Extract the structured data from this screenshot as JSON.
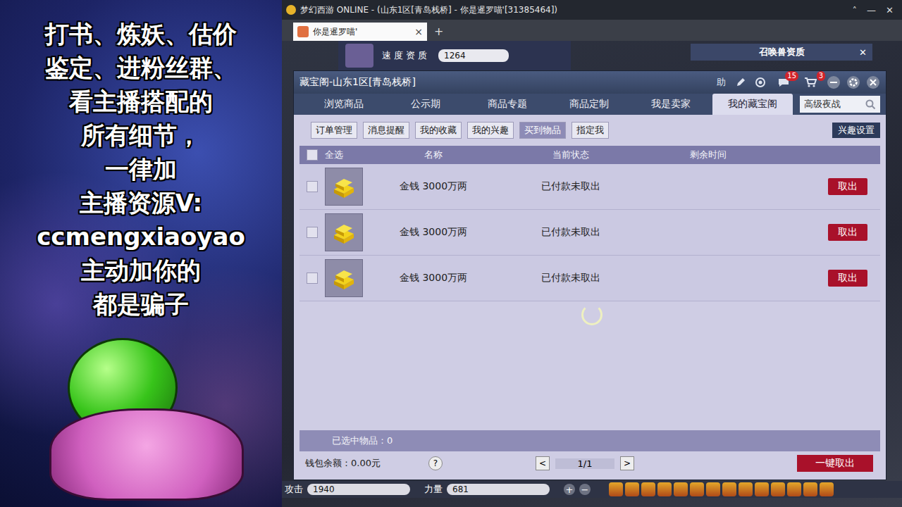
{
  "overlay": {
    "lines": [
      "打书、炼妖、估价",
      "鉴定、进粉丝群、",
      "看主播搭配的",
      "所有细节，",
      "一律加",
      "主播资源V:",
      "ccmengxiaoyao",
      "主动加你的",
      "都是骗子"
    ]
  },
  "window": {
    "title": "梦幻西游 ONLINE - (山东1区[青岛栈桥] - 你是暹罗喵'[31385464])",
    "controls": [
      "˄",
      "—",
      "✕"
    ]
  },
  "browser_tabs": [
    {
      "label": "你是暹罗喵'",
      "selected": true,
      "close": "×"
    }
  ],
  "new_tab": "+",
  "background": {
    "pet_stat": {
      "label": "速度资质",
      "value": "1264"
    },
    "pet_panel": {
      "title": "召唤兽资质",
      "close": "✕"
    },
    "attrs": [
      {
        "label": "攻击",
        "value": "1940"
      },
      {
        "label": "力量",
        "value": "681"
      }
    ],
    "attr_buttons": [
      "+",
      "−"
    ]
  },
  "dialog": {
    "title": "藏宝阁-山东1区[青岛栈桥]",
    "help": "助",
    "badges": {
      "messages": "15",
      "cart": "3"
    },
    "tabs": [
      {
        "label": "浏览商品",
        "selected": false
      },
      {
        "label": "公示期",
        "selected": false
      },
      {
        "label": "商品专题",
        "selected": false
      },
      {
        "label": "商品定制",
        "selected": false
      },
      {
        "label": "我是卖家",
        "selected": false
      },
      {
        "label": "我的藏宝阁",
        "selected": true
      }
    ],
    "search": {
      "value": "高级夜战"
    },
    "subtabs": [
      {
        "label": "订单管理",
        "selected": false
      },
      {
        "label": "消息提醒",
        "selected": false
      },
      {
        "label": "我的收藏",
        "selected": false
      },
      {
        "label": "我的兴趣",
        "selected": false
      },
      {
        "label": "买到物品",
        "selected": true
      },
      {
        "label": "指定我",
        "selected": false
      }
    ],
    "interest_button": "兴趣设置",
    "table": {
      "select_all": {
        "label": "全选",
        "checked": false
      },
      "columns": [
        "名称",
        "当前状态",
        "剩余时间"
      ],
      "rows": [
        {
          "name": "金钱 3000万两",
          "status": "已付款未取出",
          "remaining": "",
          "checked": false,
          "action": "取出"
        },
        {
          "name": "金钱 3000万两",
          "status": "已付款未取出",
          "remaining": "",
          "checked": false,
          "action": "取出"
        },
        {
          "name": "金钱 3000万两",
          "status": "已付款未取出",
          "remaining": "",
          "checked": false,
          "action": "取出"
        }
      ],
      "loading": true
    },
    "selected_count": "已选中物品：0",
    "wallet": "钱包余额：0.00元",
    "help_mark": "?",
    "pager": {
      "prev": "<",
      "page": "1/1",
      "next": ">"
    },
    "take_all": "一键取出"
  }
}
